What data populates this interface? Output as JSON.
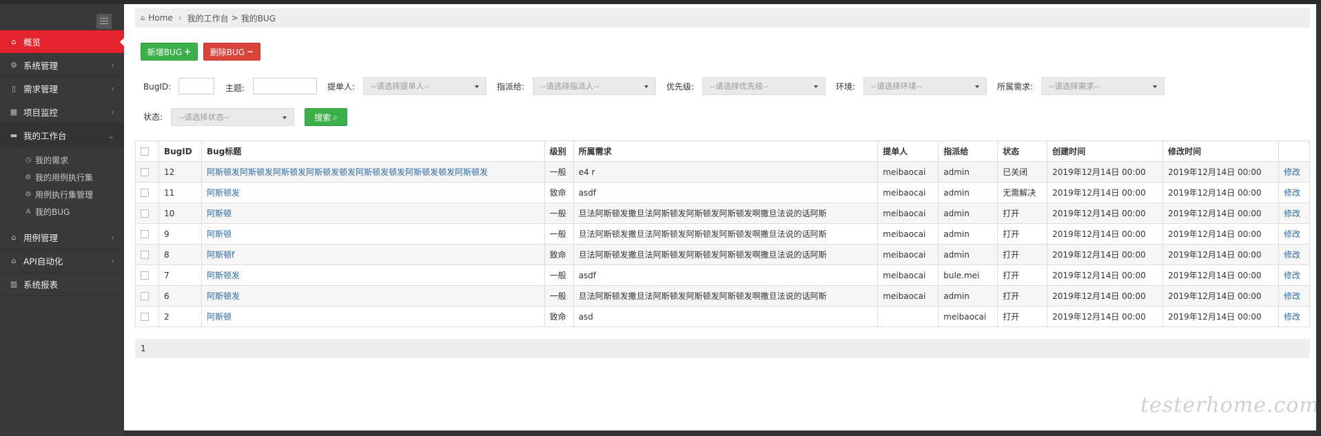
{
  "sidebar": {
    "items": [
      {
        "label": "概览",
        "icon": "home-icon",
        "active": true
      },
      {
        "label": "系统管理",
        "icon": "cogs-icon"
      },
      {
        "label": "需求管理",
        "icon": "bookmark-icon"
      },
      {
        "label": "项目监控",
        "icon": "table-icon"
      },
      {
        "label": "我的工作台",
        "icon": "briefcase-icon",
        "open": true
      },
      {
        "label": "用例管理",
        "icon": "bank-icon"
      },
      {
        "label": "API自动化",
        "icon": "bank-icon"
      },
      {
        "label": "系统报表",
        "icon": "bar-chart-icon"
      }
    ],
    "submenu": [
      {
        "label": "我的需求",
        "icon": "clock-icon"
      },
      {
        "label": "我的用例执行集",
        "icon": "cogs-icon"
      },
      {
        "label": "用例执行集管理",
        "icon": "cogs-icon"
      },
      {
        "label": "我的BUG",
        "icon": "font-icon"
      }
    ]
  },
  "breadcrumb": {
    "home": "Home",
    "level1": "我的工作台",
    "separator": ">",
    "level2": "我的BUG"
  },
  "toolbar": {
    "add_label": "新增BUG",
    "delete_label": "删除BUG"
  },
  "filters": {
    "bugid_label": "BugID:",
    "title_label": "主题:",
    "reporter_label": "提单人:",
    "reporter_placeholder": "--请选择提单人--",
    "assignee_label": "指派给:",
    "assignee_placeholder": "--请选择指派人--",
    "priority_label": "优先级:",
    "priority_placeholder": "--请选择优先级--",
    "env_label": "环境:",
    "env_placeholder": "--请选择环境--",
    "req_label": "所属需求:",
    "req_placeholder": "--请选择需求--",
    "status_label": "状态:",
    "status_placeholder": "--请选择状态--",
    "search_label": "搜索"
  },
  "table": {
    "headers": [
      "BugID",
      "Bug标题",
      "级别",
      "所属需求",
      "提单人",
      "指派给",
      "状态",
      "创建时间",
      "修改时间"
    ],
    "action_label": "修改",
    "rows": [
      {
        "id": "12",
        "title": "阿斯顿发阿斯顿发阿斯顿发阿斯顿发顿发阿斯顿发顿发阿斯顿发顿发阿斯顿发",
        "level": "一般",
        "req": "e4 r",
        "reporter": "meibaocai",
        "assignee": "admin",
        "status": "已关闭",
        "created": "2019年12月14日 00:00",
        "modified": "2019年12月14日 00:00"
      },
      {
        "id": "11",
        "title": "阿斯顿发",
        "level": "致命",
        "req": "asdf",
        "reporter": "meibaocai",
        "assignee": "admin",
        "status": "无需解决",
        "created": "2019年12月14日 00:00",
        "modified": "2019年12月14日 00:00"
      },
      {
        "id": "10",
        "title": "阿斯顿",
        "level": "一般",
        "req": "旦法阿斯顿发撒旦法阿斯顿发阿斯顿发阿斯顿发啊撒旦法说的话阿斯",
        "reporter": "meibaocai",
        "assignee": "admin",
        "status": "打开",
        "created": "2019年12月14日 00:00",
        "modified": "2019年12月14日 00:00"
      },
      {
        "id": "9",
        "title": "阿斯顿",
        "level": "一般",
        "req": "旦法阿斯顿发撒旦法阿斯顿发阿斯顿发阿斯顿发啊撒旦法说的话阿斯",
        "reporter": "meibaocai",
        "assignee": "admin",
        "status": "打开",
        "created": "2019年12月14日 00:00",
        "modified": "2019年12月14日 00:00"
      },
      {
        "id": "8",
        "title": "阿斯顿f",
        "level": "致命",
        "req": "旦法阿斯顿发撒旦法阿斯顿发阿斯顿发阿斯顿发啊撒旦法说的话阿斯",
        "reporter": "meibaocai",
        "assignee": "admin",
        "status": "打开",
        "created": "2019年12月14日 00:00",
        "modified": "2019年12月14日 00:00"
      },
      {
        "id": "7",
        "title": "阿斯顿发",
        "level": "一般",
        "req": "asdf",
        "reporter": "meibaocai",
        "assignee": "bule.mei",
        "status": "打开",
        "created": "2019年12月14日 00:00",
        "modified": "2019年12月14日 00:00"
      },
      {
        "id": "6",
        "title": "阿斯顿发",
        "level": "一般",
        "req": "旦法阿斯顿发撒旦法阿斯顿发阿斯顿发阿斯顿发啊撒旦法说的话阿斯",
        "reporter": "meibaocai",
        "assignee": "admin",
        "status": "打开",
        "created": "2019年12月14日 00:00",
        "modified": "2019年12月14日 00:00"
      },
      {
        "id": "2",
        "title": "阿斯顿",
        "level": "致命",
        "req": "asd",
        "reporter": "",
        "assignee": "meibaocai",
        "status": "打开",
        "created": "2019年12月14日 00:00",
        "modified": "2019年12月14日 00:00"
      }
    ]
  },
  "pager": {
    "page": "1"
  },
  "watermark": "testerhome.com"
}
